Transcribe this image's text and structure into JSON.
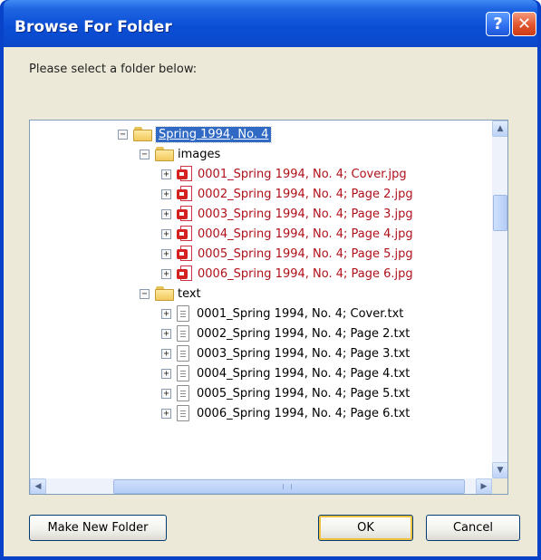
{
  "window": {
    "title": "Browse For Folder",
    "help_glyph": "?",
    "close_glyph": "✕"
  },
  "prompt": "Please select a folder below:",
  "tree": {
    "collapse_glyph": "−",
    "expand_glyph": "+",
    "root": {
      "label": "Spring 1994, No. 4",
      "selected": true
    },
    "folders": [
      {
        "label": "images",
        "items": [
          "0001_Spring 1994, No. 4; Cover.jpg",
          "0002_Spring 1994, No. 4; Page 2.jpg",
          "0003_Spring 1994, No. 4; Page 3.jpg",
          "0004_Spring 1994, No. 4; Page 4.jpg",
          "0005_Spring 1994, No. 4; Page 5.jpg",
          "0006_Spring 1994, No. 4; Page 6.jpg"
        ]
      },
      {
        "label": "text",
        "items": [
          "0001_Spring 1994, No. 4; Cover.txt",
          "0002_Spring 1994, No. 4; Page 2.txt",
          "0003_Spring 1994, No. 4; Page 3.txt",
          "0004_Spring 1994, No. 4; Page 4.txt",
          "0005_Spring 1994, No. 4; Page 5.txt",
          "0006_Spring 1994, No. 4; Page 6.txt"
        ]
      }
    ]
  },
  "scrollbars": {
    "up": "▲",
    "down": "▼",
    "left": "◀",
    "right": "▶"
  },
  "buttons": {
    "make_new_folder": "Make New Folder",
    "ok": "OK",
    "cancel": "Cancel"
  }
}
